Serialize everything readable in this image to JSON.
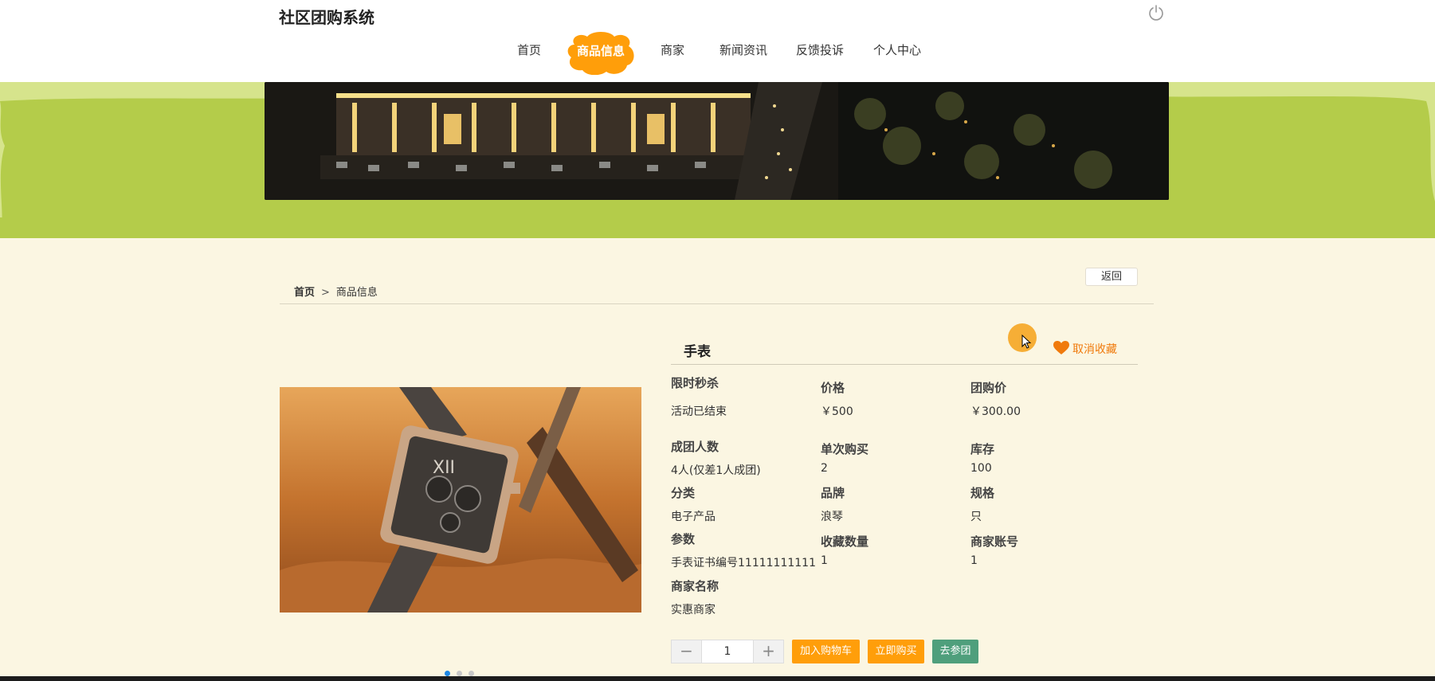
{
  "header": {
    "site_title": "社区团购系统",
    "nav": [
      {
        "label": "首页"
      },
      {
        "label": "商品信息",
        "active": true
      },
      {
        "label": "商家"
      },
      {
        "label": "新闻资讯"
      },
      {
        "label": "反馈投诉"
      },
      {
        "label": "个人中心"
      }
    ]
  },
  "breadcrumb": {
    "home": "首页",
    "separator": ">",
    "current": "商品信息"
  },
  "back_label": "返回",
  "product": {
    "name": "手表",
    "favorite_label": "取消收藏",
    "attributes": {
      "flash_sale": {
        "label": "限时秒杀",
        "value": "活动已结束"
      },
      "price": {
        "label": "价格",
        "value": "￥500"
      },
      "group_price": {
        "label": "团购价",
        "value": "￥300.00"
      },
      "group_size": {
        "label": "成团人数",
        "value": "4人(仅差1人成团)"
      },
      "single_purchase": {
        "label": "单次购买",
        "value": "2"
      },
      "stock": {
        "label": "库存",
        "value": "100"
      },
      "category": {
        "label": "分类",
        "value": "电子产品"
      },
      "brand": {
        "label": "品牌",
        "value": "浪琴"
      },
      "spec": {
        "label": "规格",
        "value": "只"
      },
      "params": {
        "label": "参数",
        "value": "手表证书编号11111111111"
      },
      "favorites_count": {
        "label": "收藏数量",
        "value": "1"
      },
      "merchant_account": {
        "label": "商家账号",
        "value": "1"
      },
      "merchant_name": {
        "label": "商家名称",
        "value": "实惠商家"
      }
    },
    "quantity": "1",
    "carousel": {
      "count": 3,
      "active_index": 0
    }
  },
  "actions": {
    "minus": "−",
    "plus": "+",
    "add_to_cart": "加入购物车",
    "buy_now": "立即购买",
    "join_group": "去参团"
  },
  "colors": {
    "accent_orange": "#ff9e0a",
    "join_green": "#4f9f7c",
    "banner_green": "#b4cc4a",
    "favorite_orange": "#f07a0c",
    "carousel_active": "#1e88e5"
  },
  "icons": {
    "power": "power-icon",
    "heart": "heart-icon"
  }
}
